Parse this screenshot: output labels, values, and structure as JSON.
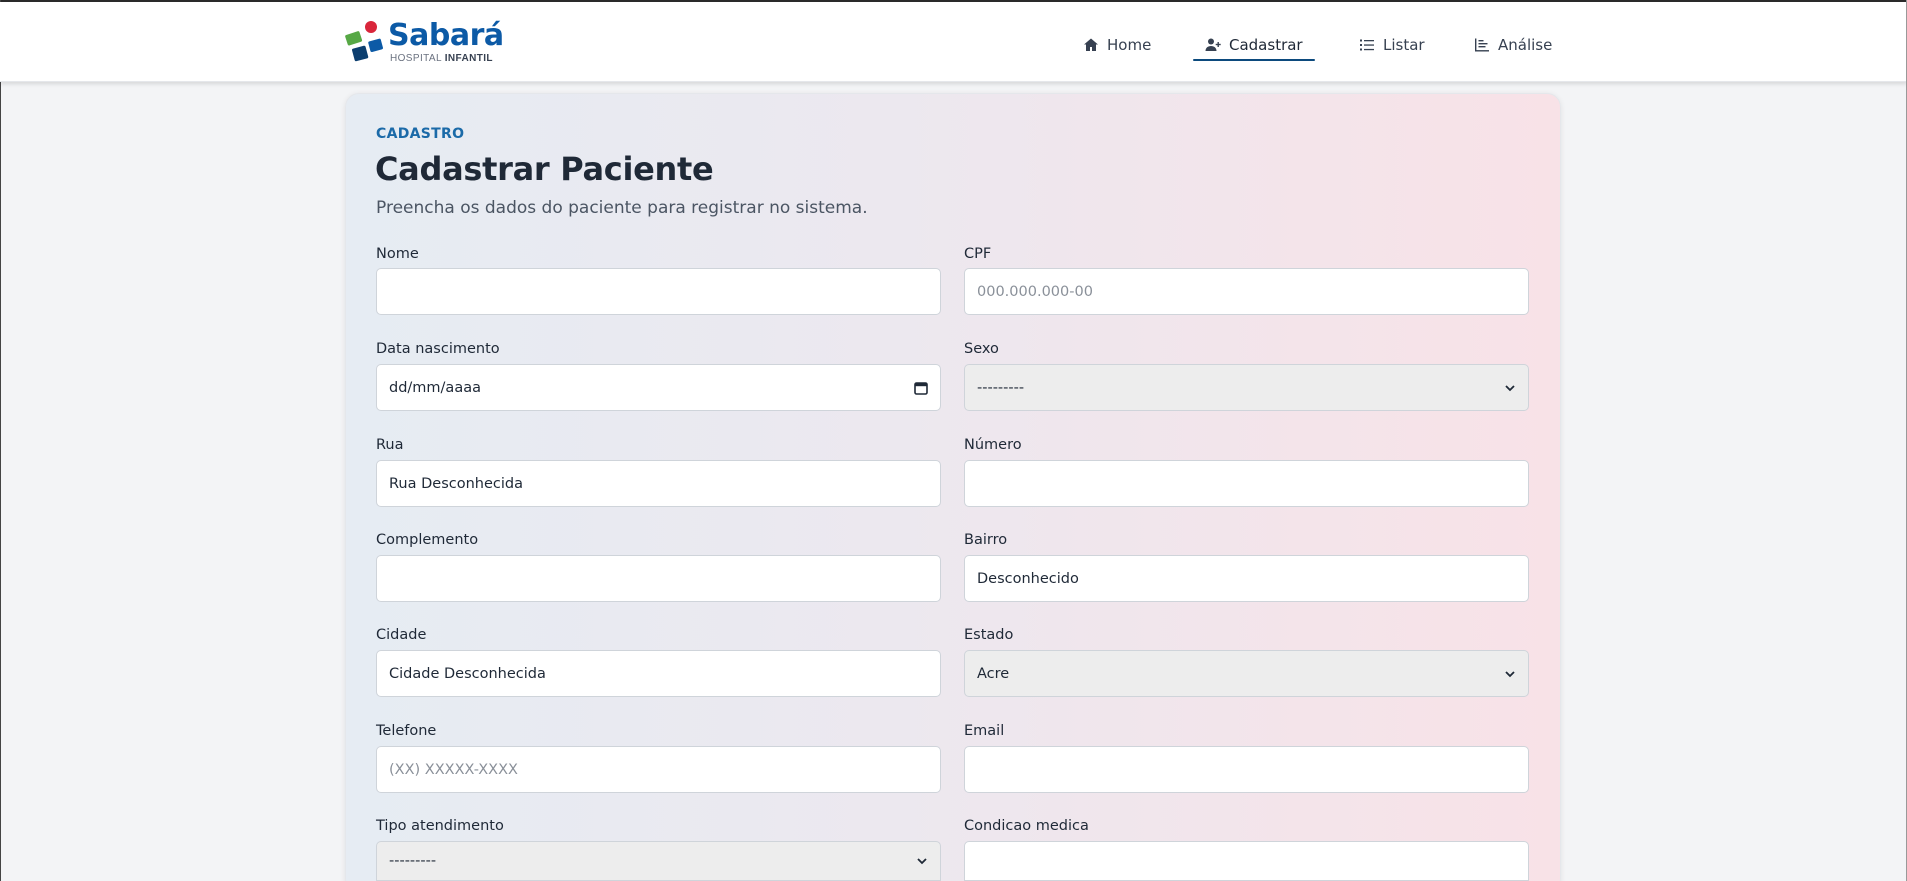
{
  "brand": {
    "name": "Sabará",
    "sub_regular": "HOSPITAL ",
    "sub_bold": "INFANTIL",
    "colors": {
      "primary": "#0c5aa6",
      "accent_red": "#d9263b",
      "accent_green": "#57a845",
      "accent_navy": "#0c3e6f"
    }
  },
  "nav": {
    "items": [
      {
        "label": "Home",
        "icon": "home-icon"
      },
      {
        "label": "Cadastrar",
        "icon": "user-plus-icon",
        "active": true
      },
      {
        "label": "Listar",
        "icon": "list-icon"
      },
      {
        "label": "Análise",
        "icon": "chart-icon"
      }
    ]
  },
  "page": {
    "eyebrow": "CADASTRO",
    "title": "Cadastrar Paciente",
    "subtitle": "Preencha os dados do paciente para registrar no sistema."
  },
  "form": {
    "nome": {
      "label": "Nome",
      "value": ""
    },
    "cpf": {
      "label": "CPF",
      "placeholder": "000.000.000-00"
    },
    "data_nascimento": {
      "label": "Data nascimento",
      "value": "dd/mm/aaaa"
    },
    "sexo": {
      "label": "Sexo",
      "value": "---------"
    },
    "rua": {
      "label": "Rua",
      "value": "Rua Desconhecida"
    },
    "numero": {
      "label": "Número",
      "value": ""
    },
    "complemento": {
      "label": "Complemento",
      "value": ""
    },
    "bairro": {
      "label": "Bairro",
      "value": "Desconhecido"
    },
    "cidade": {
      "label": "Cidade",
      "value": "Cidade Desconhecida"
    },
    "estado": {
      "label": "Estado",
      "value": "Acre"
    },
    "telefone": {
      "label": "Telefone",
      "placeholder": "(XX) XXXXX-XXXX"
    },
    "email": {
      "label": "Email",
      "value": ""
    },
    "tipo_atendimento": {
      "label": "Tipo atendimento",
      "value": "---------"
    },
    "condicao_medica": {
      "label": "Condicao medica",
      "value": ""
    }
  }
}
